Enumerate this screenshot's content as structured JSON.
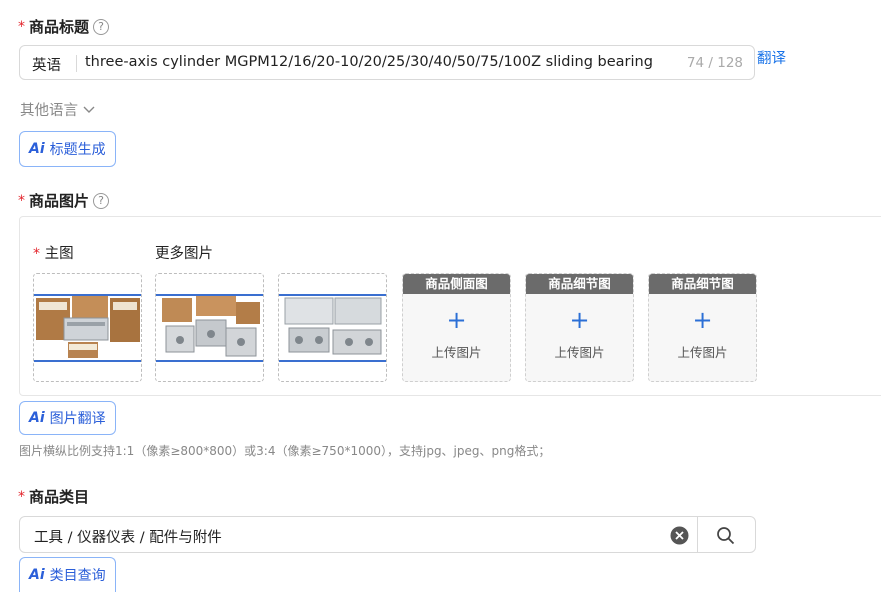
{
  "title_section": {
    "label": "商品标题",
    "language": "英语",
    "title_value": "three-axis cylinder MGPM12/16/20-10/20/25/30/40/50/75/100Z sliding bearing",
    "char_count": "74 / 128",
    "translate_link": "翻译",
    "other_languages": "其他语言",
    "ai_button": "标题生成"
  },
  "images_section": {
    "label": "商品图片",
    "main_label": "主图",
    "more_label": "更多图片",
    "slots": [
      {
        "header": "商品侧面图",
        "upload": "上传图片"
      },
      {
        "header": "商品细节图",
        "upload": "上传图片"
      },
      {
        "header": "商品细节图",
        "upload": "上传图片"
      }
    ],
    "ai_button": "图片翻译",
    "hint": "图片横纵比例支持1:1（像素≥800*800）或3:4（像素≥750*1000），支持jpg、jpeg、png格式；"
  },
  "category_section": {
    "label": "商品类目",
    "value": "工具 / 仪器仪表 / 配件与附件",
    "ai_button": "类目查询"
  },
  "colors": {
    "required": "#e3242b",
    "accent": "#2b5fd9",
    "link": "#1a73e8"
  }
}
